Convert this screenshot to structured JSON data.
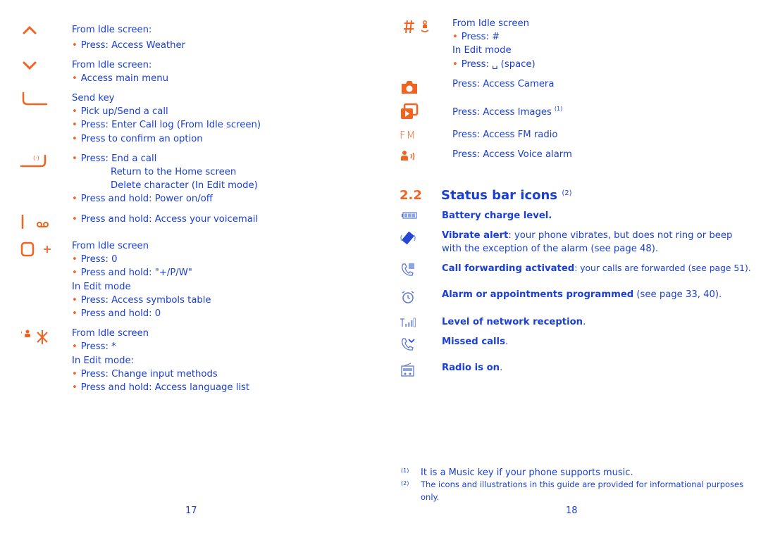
{
  "left_page": {
    "page_number": "17",
    "keys": [
      {
        "icon": "up-arrow-icon",
        "lines": [
          {
            "text": "From Idle screen:",
            "bullet": false
          },
          {
            "text": "Press: Access Weather",
            "bullet": true
          }
        ]
      },
      {
        "icon": "down-arrow-icon",
        "lines": [
          {
            "text": "From Idle screen:",
            "bullet": false
          },
          {
            "text": "Access main menu",
            "bullet": true
          }
        ]
      },
      {
        "icon": "send-key-icon",
        "lines": [
          {
            "text": "Send key",
            "bullet": false
          },
          {
            "text": "Pick up/Send a call",
            "bullet": true
          },
          {
            "text": "Press: Enter Call log (From Idle screen)",
            "bullet": true
          },
          {
            "text": "Press to confirm an option",
            "bullet": true
          }
        ]
      },
      {
        "icon": "end-key-icon",
        "lines": [
          {
            "text": "Press: End a call",
            "bullet": true
          },
          {
            "text": "Return to the Home screen",
            "bullet": false
          },
          {
            "text": "Delete character (In Edit mode)",
            "bullet": false
          },
          {
            "text": "Press and hold: Power on/off",
            "bullet": true
          }
        ]
      },
      {
        "icon": "voicemail-key-icon",
        "lines": [
          {
            "text": "Press and hold: Access your voicemail",
            "bullet": true
          }
        ]
      },
      {
        "icon": "zero-plus-key-icon",
        "lines": [
          {
            "text": "From Idle screen",
            "bullet": false
          },
          {
            "text": "Press: 0",
            "bullet": true
          },
          {
            "text": "Press and hold: \"+/P/W\"",
            "bullet": true
          },
          {
            "text": "In Edit mode",
            "bullet": false
          },
          {
            "text": "Press: Access symbols table",
            "bullet": true
          },
          {
            "text": "Press and hold: 0",
            "bullet": true
          }
        ]
      },
      {
        "icon": "star-key-icon",
        "lines": [
          {
            "text": "From Idle screen",
            "bullet": false
          },
          {
            "text": "Press: *",
            "bullet": true
          },
          {
            "text": "In Edit mode:",
            "bullet": false
          },
          {
            "text": "Press: Change input methods",
            "bullet": true
          },
          {
            "text": "Press and hold: Access language list",
            "bullet": true
          }
        ]
      }
    ]
  },
  "right_page": {
    "page_number": "18",
    "keys": [
      {
        "icon": "hash-key-icon",
        "lines": [
          {
            "text": "From Idle screen",
            "bullet": false
          },
          {
            "text": "Press: #",
            "bullet": true
          },
          {
            "text": "In Edit mode",
            "bullet": false
          },
          {
            "text": "Press: ␣ (space)",
            "bullet": true
          }
        ]
      },
      {
        "icon": "camera-key-icon",
        "lines": [
          {
            "text": "Press: Access Camera",
            "bullet": false
          }
        ]
      },
      {
        "icon": "images-key-icon",
        "lines": [
          {
            "text": "Press: Access Images",
            "bullet": false,
            "note": "(1)"
          }
        ]
      },
      {
        "icon": "fm-key-icon",
        "icon_text": "FM",
        "lines": [
          {
            "text": "Press: Access FM radio",
            "bullet": false
          }
        ]
      },
      {
        "icon": "voice-alarm-key-icon",
        "lines": [
          {
            "text": "Press: Access Voice alarm",
            "bullet": false
          }
        ]
      }
    ],
    "section": {
      "number": "2.2",
      "title": "Status bar icons",
      "note": "(2)",
      "items": [
        {
          "icon": "battery-icon",
          "bold": "Battery charge level.",
          "rest": ""
        },
        {
          "icon": "vibrate-icon",
          "bold": "Vibrate alert",
          "rest": ": your phone vibrates, but does not ring or beep",
          "rest2": "with the exception of the alarm (see page 48)."
        },
        {
          "icon": "call-forward-icon",
          "bold": "Call forwarding activated",
          "rest": ": your calls are forwarded (see page 51)."
        },
        {
          "icon": "alarm-icon",
          "bold": "Alarm or appointments programmed",
          "rest": " (see page 33, 40)."
        },
        {
          "icon": "signal-icon",
          "bold": "Level of network reception",
          "rest": "."
        },
        {
          "icon": "missed-call-icon",
          "bold": "Missed calls",
          "rest": "."
        },
        {
          "icon": "radio-icon",
          "bold": "Radio is on",
          "rest": "."
        }
      ]
    },
    "footnotes": [
      {
        "mark": "(1)",
        "text": "It is a Music key if your phone supports music."
      },
      {
        "mark": "(2)",
        "text": "The icons and illustrations in this guide are provided for informational purposes",
        "text2": "only."
      }
    ]
  },
  "colors": {
    "accent": "#f26322",
    "text": "#1a3fd6",
    "icon_blue": "#5a78d8"
  }
}
